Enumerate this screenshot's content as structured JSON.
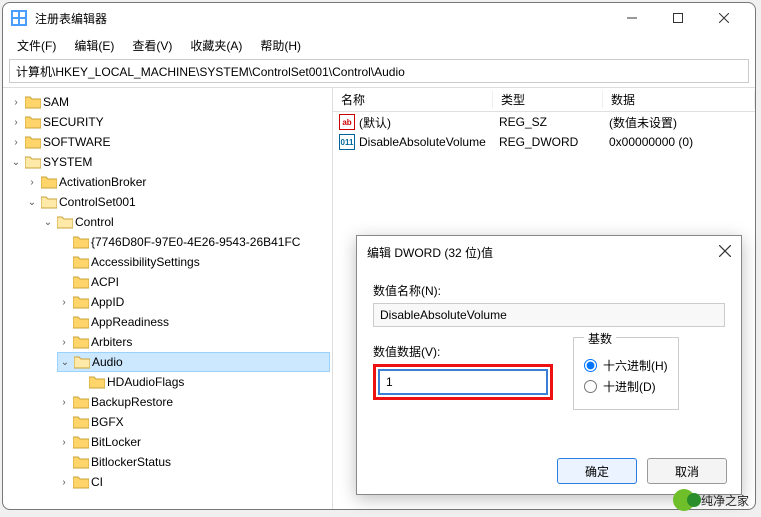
{
  "window": {
    "title": "注册表编辑器"
  },
  "menus": {
    "file": "文件(F)",
    "edit": "编辑(E)",
    "view": "查看(V)",
    "favorites": "收藏夹(A)",
    "help": "帮助(H)"
  },
  "address": "计算机\\HKEY_LOCAL_MACHINE\\SYSTEM\\ControlSet001\\Control\\Audio",
  "tree": {
    "sam": "SAM",
    "security": "SECURITY",
    "software": "SOFTWARE",
    "system": "SYSTEM",
    "activationbroker": "ActivationBroker",
    "controlset001": "ControlSet001",
    "control": "Control",
    "guid": "{7746D80F-97E0-4E26-9543-26B41FC",
    "accessibility": "AccessibilitySettings",
    "acpi": "ACPI",
    "appid": "AppID",
    "appreadiness": "AppReadiness",
    "arbiters": "Arbiters",
    "audio": "Audio",
    "hdaudioflags": "HDAudioFlags",
    "backuprestore": "BackupRestore",
    "bgfx": "BGFX",
    "bitlocker": "BitLocker",
    "bitlockerstatus": "BitlockerStatus",
    "ci": "CI"
  },
  "list": {
    "headers": {
      "name": "名称",
      "type": "类型",
      "data": "数据"
    },
    "rows": [
      {
        "icon": "str",
        "name": "(默认)",
        "type": "REG_SZ",
        "data": "(数值未设置)"
      },
      {
        "icon": "bin",
        "name": "DisableAbsoluteVolume",
        "type": "REG_DWORD",
        "data": "0x00000000 (0)"
      }
    ]
  },
  "dialog": {
    "title": "编辑 DWORD (32 位)值",
    "name_label": "数值名称(N):",
    "name_value": "DisableAbsoluteVolume",
    "data_label": "数值数据(V):",
    "data_value": "1",
    "base_label": "基数",
    "radio_hex": "十六进制(H)",
    "radio_dec": "十进制(D)",
    "ok": "确定",
    "cancel": "取消"
  },
  "watermark": "纯净之家"
}
